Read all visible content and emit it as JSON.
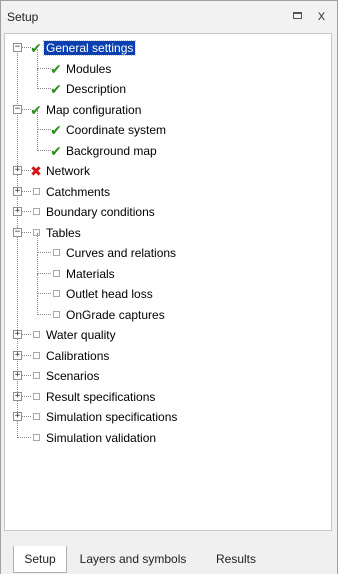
{
  "panel": {
    "title": "Setup",
    "pin_icon": "pin-icon",
    "close_glyph": "x"
  },
  "tree": [
    {
      "id": "general-settings",
      "label": "General settings",
      "status": "check",
      "level": 0,
      "expander": "-",
      "selected": true
    },
    {
      "id": "modules",
      "label": "Modules",
      "status": "check",
      "level": 1
    },
    {
      "id": "description",
      "label": "Description",
      "status": "check",
      "level": 1
    },
    {
      "id": "map-configuration",
      "label": "Map configuration",
      "status": "check",
      "level": 0,
      "expander": "-"
    },
    {
      "id": "coordinate-system",
      "label": "Coordinate system",
      "status": "check",
      "level": 1
    },
    {
      "id": "background-map",
      "label": "Background map",
      "status": "check",
      "level": 1
    },
    {
      "id": "network",
      "label": "Network",
      "status": "cross",
      "level": 0,
      "expander": "+"
    },
    {
      "id": "catchments",
      "label": "Catchments",
      "status": "empty",
      "level": 0,
      "expander": "+"
    },
    {
      "id": "boundary-conditions",
      "label": "Boundary conditions",
      "status": "empty",
      "level": 0,
      "expander": "+"
    },
    {
      "id": "tables",
      "label": "Tables",
      "status": "empty",
      "level": 0,
      "expander": "-"
    },
    {
      "id": "curves-and-relations",
      "label": "Curves and relations",
      "status": "empty",
      "level": 1
    },
    {
      "id": "materials",
      "label": "Materials",
      "status": "empty",
      "level": 1
    },
    {
      "id": "outlet-head-loss",
      "label": "Outlet head loss",
      "status": "empty",
      "level": 1
    },
    {
      "id": "ongrade-captures",
      "label": "OnGrade captures",
      "status": "empty",
      "level": 1
    },
    {
      "id": "water-quality",
      "label": "Water quality",
      "status": "empty",
      "level": 0,
      "expander": "+"
    },
    {
      "id": "calibrations",
      "label": "Calibrations",
      "status": "empty",
      "level": 0,
      "expander": "+"
    },
    {
      "id": "scenarios",
      "label": "Scenarios",
      "status": "empty",
      "level": 0,
      "expander": "+"
    },
    {
      "id": "result-specifications",
      "label": "Result specifications",
      "status": "empty",
      "level": 0,
      "expander": "+"
    },
    {
      "id": "simulation-specifications",
      "label": "Simulation specifications",
      "status": "empty",
      "level": 0,
      "expander": "+"
    },
    {
      "id": "simulation-validation",
      "label": "Simulation validation",
      "status": "empty",
      "level": 0
    }
  ],
  "status_icons": {
    "check": "✔",
    "cross": "✖",
    "empty": ""
  },
  "status_icon_names": {
    "check": "check-icon",
    "cross": "cross-icon",
    "empty": "empty-box-icon"
  },
  "colors": {
    "check": "#2e8b1e",
    "cross": "#d4161c",
    "selection": "#0a3fb0"
  },
  "tabs": [
    {
      "label": "Setup",
      "active": true
    },
    {
      "label": "Layers and symbols",
      "active": false
    },
    {
      "label": "Results",
      "active": false
    }
  ]
}
